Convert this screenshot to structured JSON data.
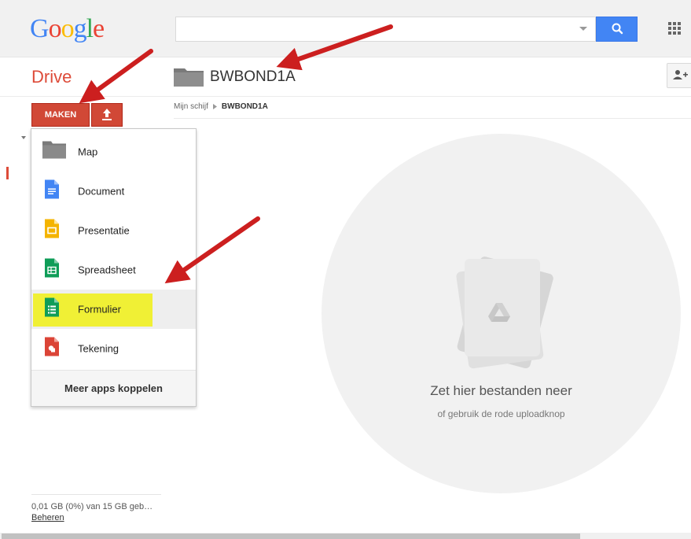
{
  "header": {
    "logo_letters": [
      {
        "ch": "G",
        "color": "#4285f4"
      },
      {
        "ch": "o",
        "color": "#ea4335"
      },
      {
        "ch": "o",
        "color": "#fbbc05"
      },
      {
        "ch": "g",
        "color": "#4285f4"
      },
      {
        "ch": "l",
        "color": "#34a853"
      },
      {
        "ch": "e",
        "color": "#ea4335"
      }
    ],
    "search": {
      "value": "",
      "placeholder": ""
    }
  },
  "app": {
    "title": "Drive",
    "accent": "#dd4b39"
  },
  "folder": {
    "name": "BWBOND1A"
  },
  "breadcrumb": {
    "root": "Mijn schijf",
    "current": "BWBOND1A"
  },
  "create": {
    "maken_label": "MAKEN"
  },
  "menu": {
    "items": [
      {
        "label": "Map",
        "icon": "folder-icon"
      },
      {
        "label": "Document",
        "icon": "docs-icon"
      },
      {
        "label": "Presentatie",
        "icon": "slides-icon"
      },
      {
        "label": "Spreadsheet",
        "icon": "sheets-icon"
      },
      {
        "label": "Formulier",
        "icon": "forms-icon"
      },
      {
        "label": "Tekening",
        "icon": "drawings-icon"
      }
    ],
    "footer": "Meer apps koppelen"
  },
  "storage": {
    "text": "0,01 GB (0%) van 15 GB geb…",
    "manage": "Beheren"
  },
  "dropzone": {
    "title": "Zet hier bestanden neer",
    "subtitle": "of gebruik de rode uploadknop"
  }
}
